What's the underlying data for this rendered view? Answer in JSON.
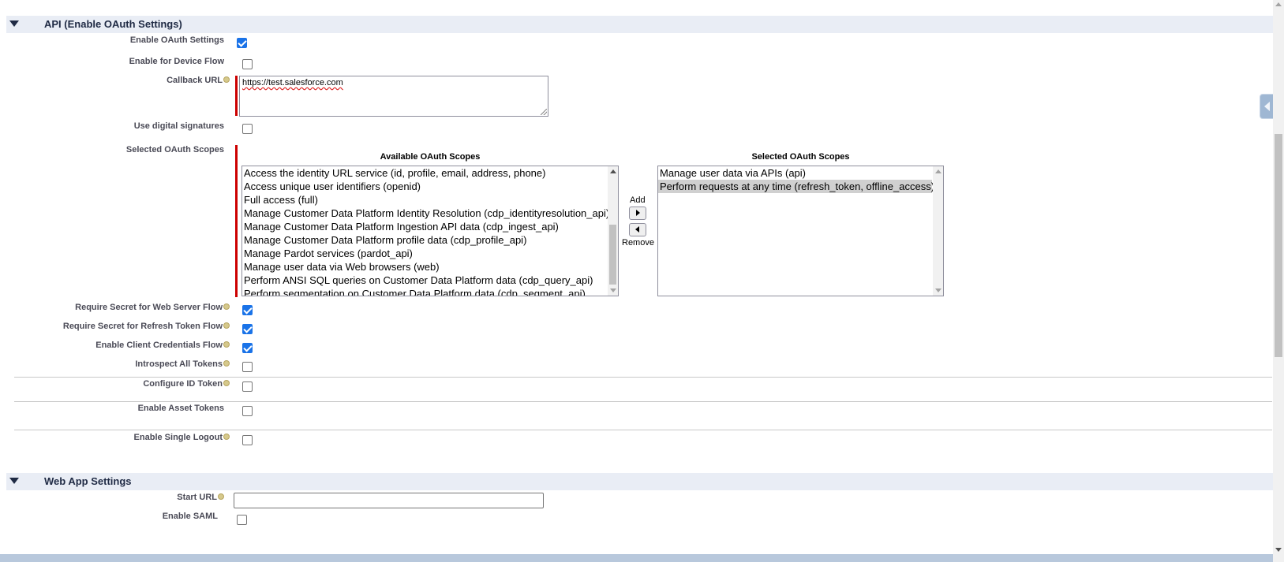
{
  "oauth_section": {
    "title": "API (Enable OAuth Settings)",
    "fields": {
      "enable_oauth": {
        "label": "Enable OAuth Settings",
        "checked": true
      },
      "device_flow": {
        "label": "Enable for Device Flow",
        "checked": false
      },
      "callback_url": {
        "label": "Callback URL",
        "value": "https://test.salesforce.com"
      },
      "digital_signatures": {
        "label": "Use digital signatures",
        "checked": false
      },
      "oauth_scopes": {
        "label": "Selected OAuth Scopes"
      },
      "secret_web_server": {
        "label": "Require Secret for Web Server Flow",
        "checked": true
      },
      "secret_refresh": {
        "label": "Require Secret for Refresh Token Flow",
        "checked": true
      },
      "client_credentials": {
        "label": "Enable Client Credentials Flow",
        "checked": true
      },
      "introspect": {
        "label": "Introspect All Tokens",
        "checked": false
      },
      "id_token": {
        "label": "Configure ID Token",
        "checked": false
      },
      "asset_tokens": {
        "label": "Enable Asset Tokens",
        "checked": false
      },
      "single_logout": {
        "label": "Enable Single Logout",
        "checked": false
      }
    },
    "scopes": {
      "available_heading": "Available OAuth Scopes",
      "selected_heading": "Selected OAuth Scopes",
      "available": [
        "Access the identity URL service (id, profile, email, address, phone)",
        "Access unique user identifiers (openid)",
        "Full access (full)",
        "Manage Customer Data Platform Identity Resolution (cdp_identityresolution_api)",
        "Manage Customer Data Platform Ingestion API data (cdp_ingest_api)",
        "Manage Customer Data Platform profile data (cdp_profile_api)",
        "Manage Pardot services (pardot_api)",
        "Manage user data via Web browsers (web)",
        "Perform ANSI SQL queries on Customer Data Platform data (cdp_query_api)",
        "Perform segmentation on Customer Data Platform data (cdp_segment_api)"
      ],
      "selected": [
        "Manage user data via APIs (api)",
        "Perform requests at any time (refresh_token, offline_access)"
      ],
      "selected_highlight_index": 1,
      "add_label": "Add",
      "remove_label": "Remove"
    }
  },
  "web_app_section": {
    "title": "Web App Settings",
    "start_url": {
      "label": "Start URL",
      "value": ""
    },
    "enable_saml": {
      "label": "Enable SAML",
      "checked": false
    }
  },
  "colors": {
    "required": "#cc0000",
    "section_bg": "#e9edf5",
    "checkbox_checked": "#1a73e8"
  }
}
